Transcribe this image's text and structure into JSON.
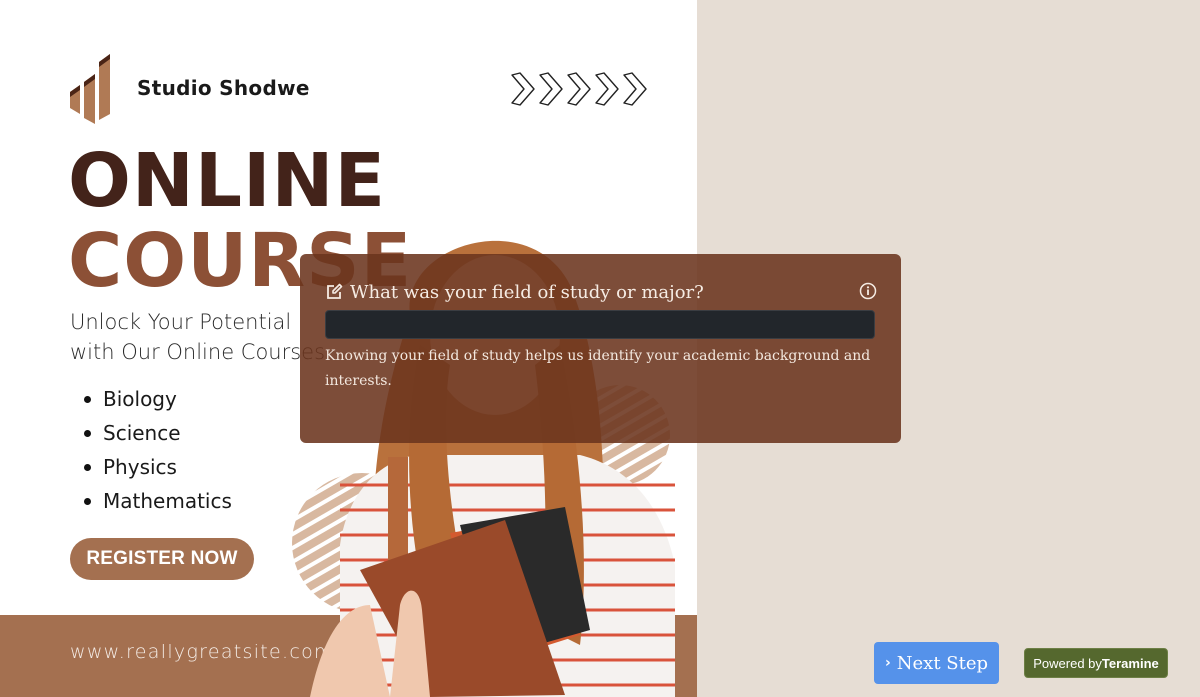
{
  "poster": {
    "brand_name": "Studio Shodwe",
    "title_line1": "ONLINE",
    "title_line2": "COURSE",
    "tagline_line1": "Unlock Your Potential",
    "tagline_line2": "with Our Online Courses",
    "subjects": [
      "Biology",
      "Science",
      "Physics",
      "Mathematics"
    ],
    "register_label": "REGISTER NOW",
    "website": "www.reallygreatsite.com",
    "colors": {
      "title_dark": "#43231a",
      "title_accent": "#8c5036",
      "band": "#a47050"
    }
  },
  "dialog": {
    "question": "What was your field of study or major?",
    "answer_value": "",
    "help_text": "Knowing your field of study helps us identify your academic background and interests."
  },
  "footer": {
    "next_label": "Next Step",
    "powered_prefix": "Powered by",
    "powered_brand": "Teramine"
  },
  "icons": {
    "edit": "edit-icon",
    "info": "info-icon",
    "chevron": "chevron-right-icon"
  }
}
